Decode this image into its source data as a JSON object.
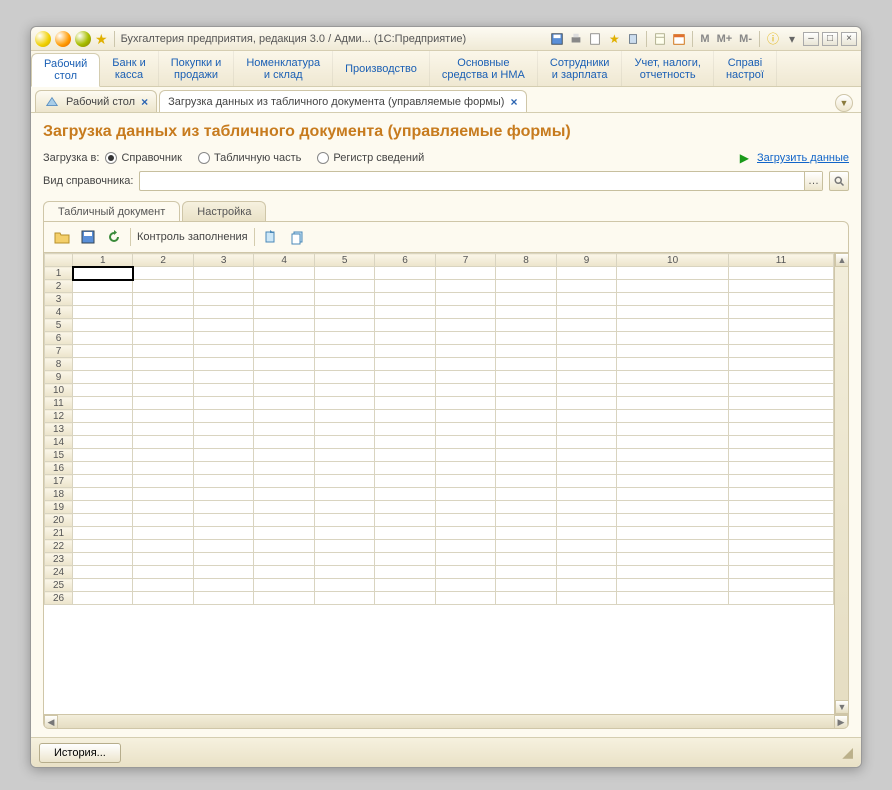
{
  "titlebar": {
    "text": "Бухгалтерия предприятия, редакция 3.0 / Адми...   (1С:Предприятие)",
    "m": "M",
    "mplus": "M+",
    "mminus": "M-"
  },
  "sections": [
    {
      "l1": "Рабочий",
      "l2": "стол",
      "active": true
    },
    {
      "l1": "Банк и",
      "l2": "касса"
    },
    {
      "l1": "Покупки и",
      "l2": "продажи"
    },
    {
      "l1": "Номенклатура",
      "l2": "и склад"
    },
    {
      "l1": "Производство",
      "l2": ""
    },
    {
      "l1": "Основные",
      "l2": "средства и НМА"
    },
    {
      "l1": "Сотрудники",
      "l2": "и зарплата"
    },
    {
      "l1": "Учет, налоги,",
      "l2": "отчетность"
    },
    {
      "l1": "Справі",
      "l2": "настрої"
    }
  ],
  "doctabs": {
    "desktop": "Рабочий стол",
    "loader": "Загрузка данных из табличного документа (управляемые формы)"
  },
  "page": {
    "title": "Загрузка данных из табличного документа (управляемые формы)",
    "load_into_label": "Загрузка в:",
    "radios": {
      "ref": "Справочник",
      "tab": "Табличную часть",
      "reg": "Регистр сведений"
    },
    "load_link": "Загрузить данные",
    "ref_type_label": "Вид справочника:"
  },
  "innerTabs": {
    "doc": "Табличный документ",
    "cfg": "Настройка"
  },
  "toolbar": {
    "check": "Контроль заполнения"
  },
  "sheet": {
    "cols": [
      "1",
      "2",
      "3",
      "4",
      "5",
      "6",
      "7",
      "8",
      "9",
      "10",
      "11"
    ],
    "rows": 26
  },
  "bottom": {
    "history": "История..."
  }
}
